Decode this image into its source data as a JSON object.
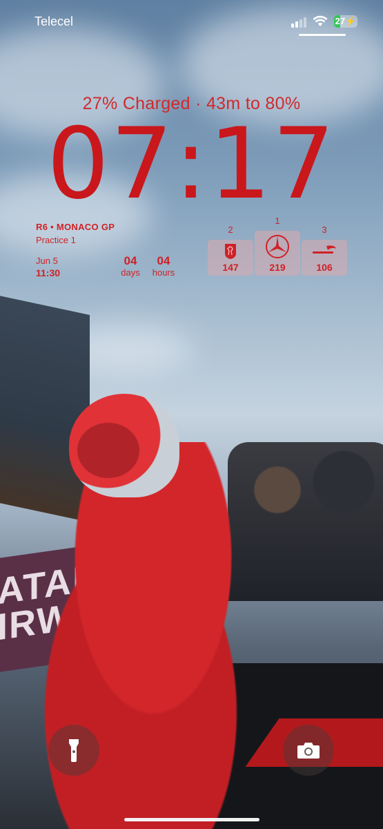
{
  "status_bar": {
    "carrier": "Telecel",
    "battery_percent": "27",
    "battery_level": 0.27,
    "charging": true,
    "signal_bars_active": 2,
    "signal_bars_total": 4
  },
  "lock_screen": {
    "charge_status": "27% Charged · 43m to 80%",
    "time": "07:17"
  },
  "race_widget": {
    "title": "R6 • MONACO GP",
    "session": "Practice 1",
    "date": "Jun 5",
    "time": "11:30",
    "countdown_days_value": "04",
    "countdown_days_unit": "days",
    "countdown_hours_value": "04",
    "countdown_hours_unit": "hours"
  },
  "standings_widget": {
    "teams": [
      {
        "rank": "2",
        "icon": "ferrari-horse-icon",
        "points": "147"
      },
      {
        "rank": "1",
        "icon": "mercedes-star-icon",
        "points": "219"
      },
      {
        "rank": "3",
        "icon": "mclaren-logo-icon",
        "points": "106"
      }
    ]
  },
  "wallpaper_text": {
    "banner_line1": "ATAR",
    "banner_line2": "IRWA"
  },
  "quick_actions": {
    "flashlight_icon": "flashlight-icon",
    "camera_icon": "camera-icon"
  },
  "colors": {
    "accent_red": "#cf2126",
    "charging_green": "#34c759"
  }
}
